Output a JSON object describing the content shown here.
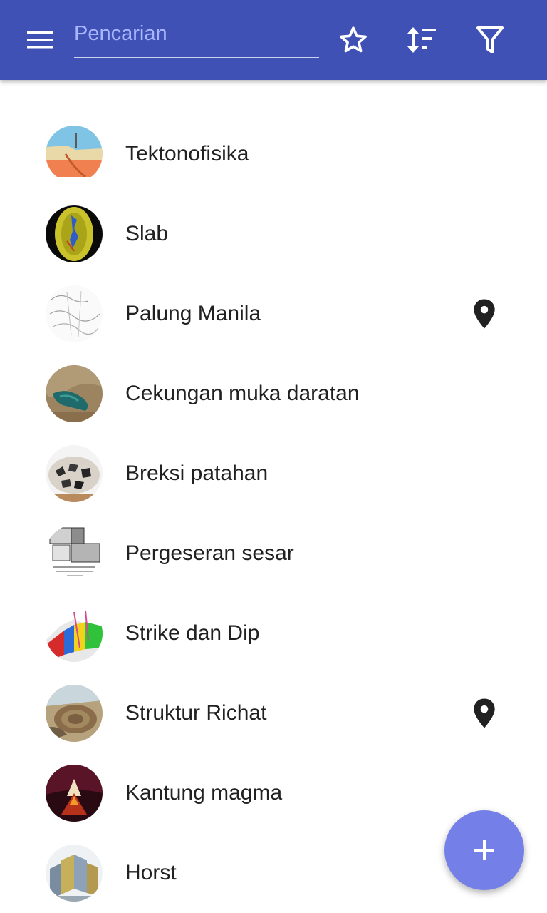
{
  "header": {
    "search": {
      "placeholder": "Pencarian",
      "value": ""
    },
    "icons": [
      "menu-icon",
      "star-icon",
      "sort-icon",
      "filter-icon"
    ],
    "background": "#3f51b5"
  },
  "items": [
    {
      "label": "Tektonofisika",
      "thumbnail": "tectonic-cross-section",
      "has_location": false
    },
    {
      "label": "Slab",
      "thumbnail": "slab-globe",
      "has_location": false
    },
    {
      "label": "Palung Manila",
      "thumbnail": "trench-sketch",
      "has_location": true
    },
    {
      "label": "Cekungan muka daratan",
      "thumbnail": "basin-satellite",
      "has_location": false
    },
    {
      "label": "Breksi patahan",
      "thumbnail": "fault-breccia-rock",
      "has_location": false
    },
    {
      "label": "Pergeseran sesar",
      "thumbnail": "fault-slip-diagram",
      "has_location": false
    },
    {
      "label": "Strike dan Dip",
      "thumbnail": "strike-dip-layers",
      "has_location": false
    },
    {
      "label": "Struktur Richat",
      "thumbnail": "richat-structure",
      "has_location": true
    },
    {
      "label": "Kantung magma",
      "thumbnail": "magma-chamber",
      "has_location": false
    },
    {
      "label": "Horst",
      "thumbnail": "horst-blocks",
      "has_location": false
    }
  ],
  "fab": {
    "icon": "plus-icon",
    "color": "#7480e8"
  }
}
